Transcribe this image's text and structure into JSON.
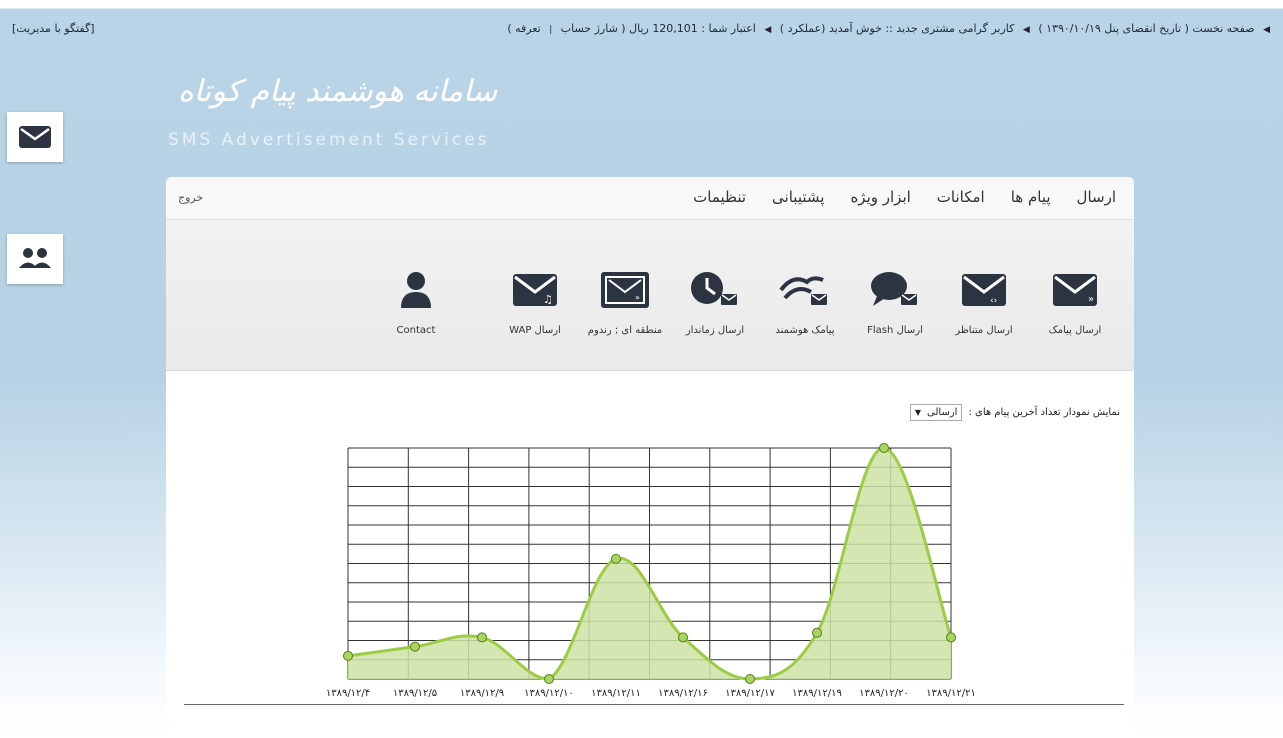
{
  "topbar": {
    "home": "صفحه نخست",
    "expiry_label": "تاریخ انقضای پنل ۱۳۹۰/۱۰/۱۹",
    "user_greeting": "کاربر گرامی  مشتری جدید :: خوش آمدید",
    "user_function": "(عملکرد )",
    "credit_label": "اعتبار شما : 120,101 ریال",
    "charge_account": "شارژ حساب",
    "tariff": "تعرفه",
    "chat_admin": "[گفتگو با مدیریت]"
  },
  "logo": {
    "title_fa": "سامانه هوشمند پیام کوتاه",
    "title_en": "SMS Advertisement Services"
  },
  "menu": {
    "items": [
      "ارسال",
      "پیام ها",
      "امکانات",
      "ابزار ویژه",
      "پشتیبانی",
      "تنظیمات"
    ],
    "logout": "خروج"
  },
  "tools": [
    {
      "label": "ارسال پیامک",
      "icon": "envelope-icon"
    },
    {
      "label": "ارسال متناظر",
      "icon": "envelope-code-icon"
    },
    {
      "label": "ارسال Flash",
      "icon": "chat-bubble-icon"
    },
    {
      "label": "پیامک هوشمند",
      "icon": "smart-sms-icon"
    },
    {
      "label": "ارسال زماندار",
      "icon": "clock-envelope-icon"
    },
    {
      "label": "منطقه ای ; رندوم",
      "icon": "envelope-stack-icon"
    },
    {
      "label": "ارسال WAP",
      "icon": "wap-envelope-icon"
    },
    {
      "label": "Contact",
      "icon": "person-icon"
    }
  ],
  "chart_control": {
    "label": "نمایش نمودار تعداد آخرین پیام های :",
    "selected": "ارسالی"
  },
  "colors": {
    "line": "#9ccc45",
    "fill": "#cde3a4",
    "point": "#a8d65e",
    "grid": "#333333"
  },
  "chart_data": {
    "type": "area",
    "x": [
      "۱۳۸۹/۱۲/۴",
      "۱۳۸۹/۱۲/۵",
      "۱۳۸۹/۱۲/۹",
      "۱۳۸۹/۱۲/۱۰",
      "۱۳۸۹/۱۲/۱۱",
      "۱۳۸۹/۱۲/۱۶",
      "۱۳۸۹/۱۲/۱۷",
      "۱۳۸۹/۱۲/۱۹",
      "۱۳۸۹/۱۲/۲۰",
      "۱۳۸۹/۱۲/۲۱"
    ],
    "values": [
      10,
      14,
      18,
      0,
      52,
      18,
      0,
      20,
      100,
      18
    ],
    "ylim": [
      0,
      100
    ],
    "grid": true,
    "title": "",
    "xlabel": "",
    "ylabel": ""
  }
}
